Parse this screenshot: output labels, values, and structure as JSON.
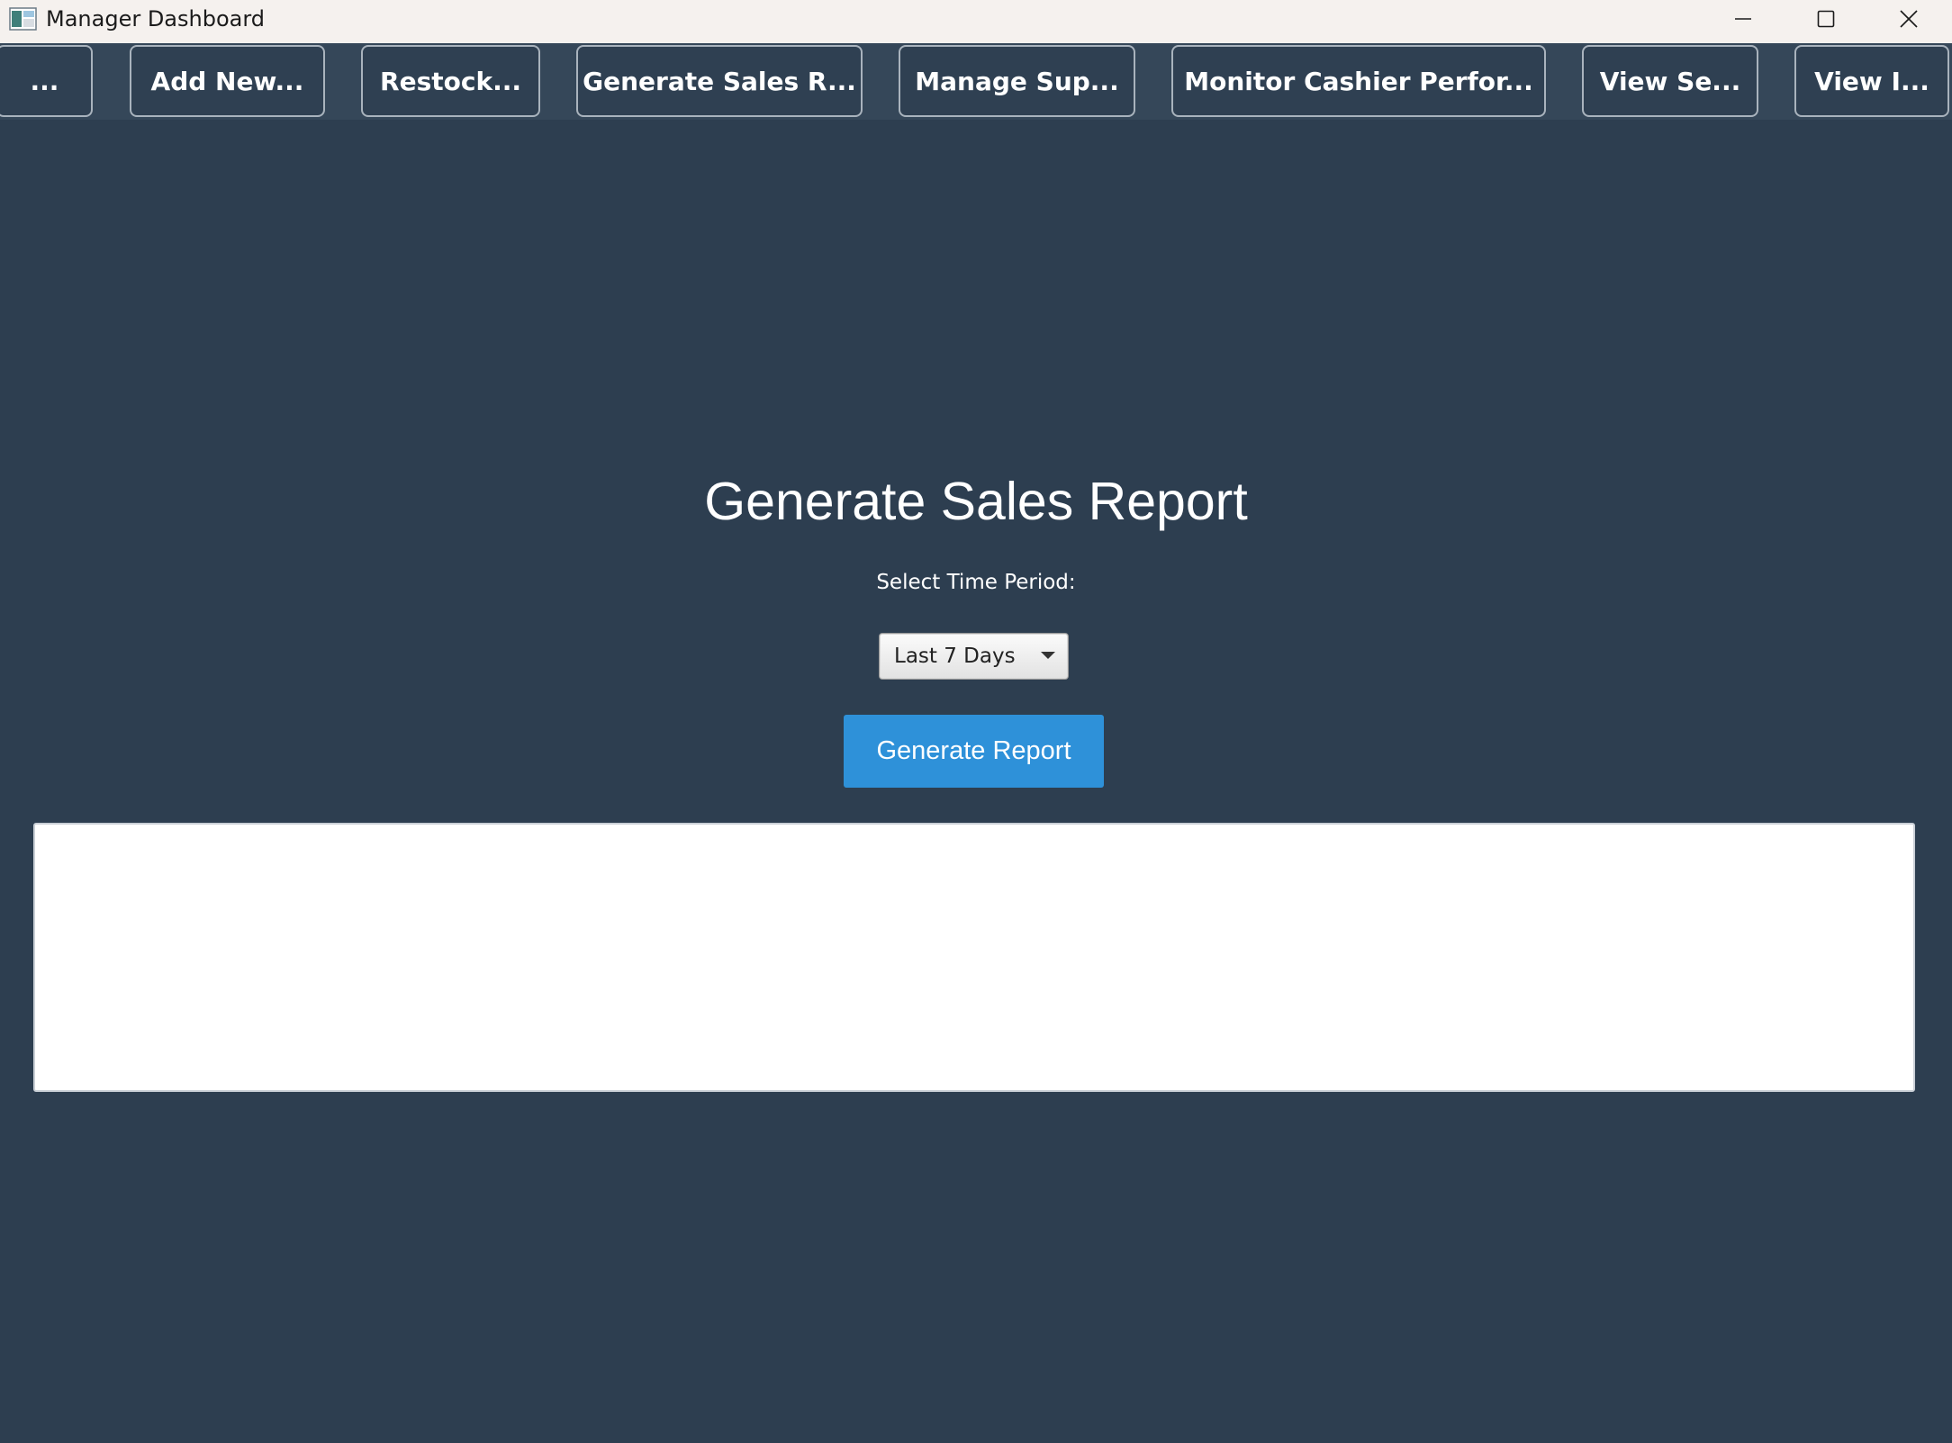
{
  "window": {
    "title": "Manager Dashboard"
  },
  "nav": {
    "buttons": [
      {
        "label": "..."
      },
      {
        "label": "Add New..."
      },
      {
        "label": "Restock..."
      },
      {
        "label": "Generate Sales R..."
      },
      {
        "label": "Manage Sup..."
      },
      {
        "label": "Monitor Cashier Perfor..."
      },
      {
        "label": "View Se..."
      },
      {
        "label": "View I..."
      }
    ]
  },
  "main": {
    "heading": "Generate Sales Report",
    "period_label": "Select Time Period:",
    "period_selected": "Last 7 Days",
    "generate_label": "Generate Report",
    "report_text": ""
  },
  "colors": {
    "background": "#2d3e50",
    "toolbar": "#354759",
    "accent": "#2e91d9"
  }
}
